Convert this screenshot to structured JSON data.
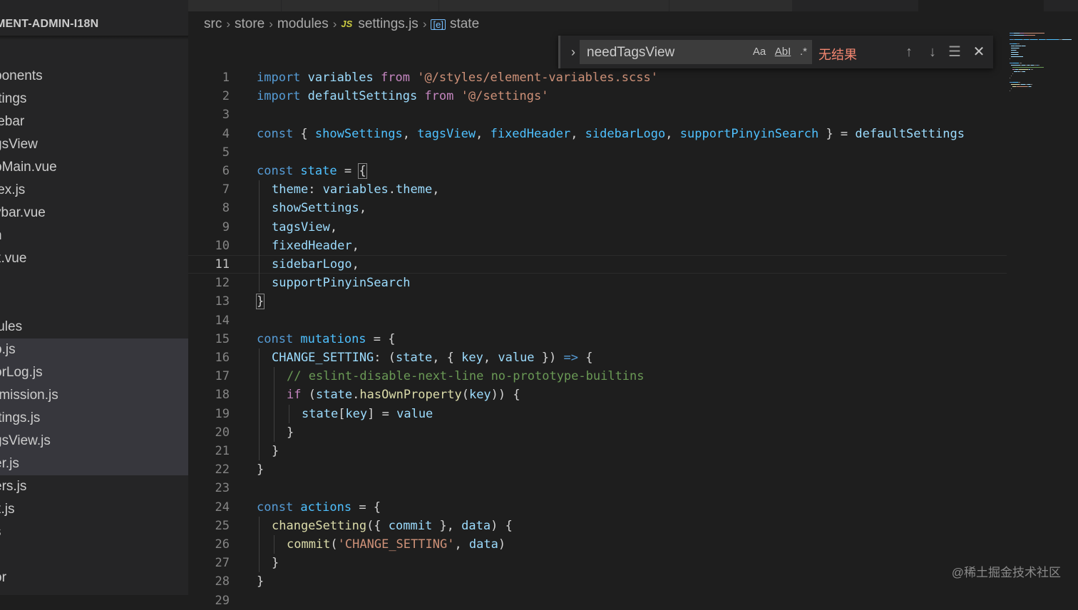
{
  "explorer": {
    "title": "MENT-ADMIN-I18N",
    "items": [
      {
        "label": "t",
        "selected": false
      },
      {
        "label": "ponents",
        "selected": false
      },
      {
        "label": "ttings",
        "selected": false
      },
      {
        "label": "lebar",
        "selected": false
      },
      {
        "label": "gsView",
        "selected": false
      },
      {
        "label": "pMain.vue",
        "selected": false
      },
      {
        "label": "lex.js",
        "selected": false
      },
      {
        "label": "vbar.vue",
        "selected": false
      },
      {
        "label": "n",
        "selected": false
      },
      {
        "label": "x.vue",
        "selected": false
      },
      {
        "label": "r",
        "selected": false
      },
      {
        "label": "",
        "selected": false
      },
      {
        "label": "lules",
        "selected": false
      },
      {
        "label": "p.js",
        "selected": true
      },
      {
        "label": "orLog.js",
        "selected": true
      },
      {
        "label": "rmission.js",
        "selected": true
      },
      {
        "label": "ttings.js",
        "selected": true
      },
      {
        "label": "gsView.js",
        "selected": true
      },
      {
        "label": "er.js",
        "selected": true
      },
      {
        "label": "ers.js",
        "selected": false
      },
      {
        "label": "x.js",
        "selected": false
      },
      {
        "label": "s",
        "selected": false
      },
      {
        "label": "",
        "selected": false
      },
      {
        "label": "or",
        "selected": false
      }
    ]
  },
  "breadcrumb": {
    "src": "src",
    "store": "store",
    "modules": "modules",
    "file_badge": "JS",
    "file": "settings.js",
    "symbol_badge": "[e]",
    "symbol": "state"
  },
  "find": {
    "value": "needTagsView",
    "match_case": "Aa",
    "whole_word": "AbI",
    "regex": ".*",
    "result": "无结果"
  },
  "editor": {
    "current_line": 11,
    "lines": [
      {
        "n": "1",
        "indent": 0,
        "t": [
          [
            "k",
            "import "
          ],
          [
            "v",
            "variables"
          ],
          [
            "kc",
            " from "
          ],
          [
            "s",
            "'@/styles/element-variables.scss'"
          ]
        ]
      },
      {
        "n": "2",
        "indent": 0,
        "t": [
          [
            "k",
            "import "
          ],
          [
            "v",
            "defaultSettings"
          ],
          [
            "kc",
            " from "
          ],
          [
            "s",
            "'@/settings'"
          ]
        ]
      },
      {
        "n": "3",
        "indent": 0,
        "t": []
      },
      {
        "n": "4",
        "indent": 0,
        "t": [
          [
            "k",
            "const "
          ],
          [
            "p",
            "{ "
          ],
          [
            "c",
            "showSettings"
          ],
          [
            "p",
            ", "
          ],
          [
            "c",
            "tagsView"
          ],
          [
            "p",
            ", "
          ],
          [
            "c",
            "fixedHeader"
          ],
          [
            "p",
            ", "
          ],
          [
            "c",
            "sidebarLogo"
          ],
          [
            "p",
            ", "
          ],
          [
            "c",
            "supportPinyinSearch"
          ],
          [
            "p",
            " } = "
          ],
          [
            "v",
            "defaultSettings"
          ]
        ]
      },
      {
        "n": "5",
        "indent": 0,
        "t": []
      },
      {
        "n": "6",
        "indent": 0,
        "t": [
          [
            "k",
            "const "
          ],
          [
            "c",
            "state"
          ],
          [
            "p",
            " = "
          ],
          [
            "pb",
            "{"
          ]
        ]
      },
      {
        "n": "7",
        "indent": 1,
        "t": [
          [
            "v",
            "theme"
          ],
          [
            "p",
            ": "
          ],
          [
            "v",
            "variables"
          ],
          [
            "p",
            "."
          ],
          [
            "v",
            "theme"
          ],
          [
            "p",
            ","
          ]
        ]
      },
      {
        "n": "8",
        "indent": 1,
        "t": [
          [
            "v",
            "showSettings"
          ],
          [
            "p",
            ","
          ]
        ]
      },
      {
        "n": "9",
        "indent": 1,
        "t": [
          [
            "v",
            "tagsView"
          ],
          [
            "p",
            ","
          ]
        ]
      },
      {
        "n": "10",
        "indent": 1,
        "t": [
          [
            "v",
            "fixedHeader"
          ],
          [
            "p",
            ","
          ]
        ]
      },
      {
        "n": "11",
        "indent": 1,
        "t": [
          [
            "v",
            "sidebarLogo"
          ],
          [
            "p",
            ","
          ]
        ]
      },
      {
        "n": "12",
        "indent": 1,
        "t": [
          [
            "v",
            "supportPinyinSearch"
          ]
        ]
      },
      {
        "n": "13",
        "indent": 0,
        "t": [
          [
            "pb",
            "}"
          ]
        ]
      },
      {
        "n": "14",
        "indent": 0,
        "t": []
      },
      {
        "n": "15",
        "indent": 0,
        "t": [
          [
            "k",
            "const "
          ],
          [
            "c",
            "mutations"
          ],
          [
            "p",
            " = {"
          ]
        ]
      },
      {
        "n": "16",
        "indent": 1,
        "t": [
          [
            "v",
            "CHANGE_SETTING"
          ],
          [
            "p",
            ": ("
          ],
          [
            "v",
            "state"
          ],
          [
            "p",
            ", { "
          ],
          [
            "v",
            "key"
          ],
          [
            "p",
            ", "
          ],
          [
            "v",
            "value"
          ],
          [
            "p",
            " }) "
          ],
          [
            "k",
            "=>"
          ],
          [
            "p",
            " {"
          ]
        ]
      },
      {
        "n": "17",
        "indent": 2,
        "t": [
          [
            "cm",
            "// eslint-disable-next-line no-prototype-builtins"
          ]
        ]
      },
      {
        "n": "18",
        "indent": 2,
        "t": [
          [
            "kc",
            "if "
          ],
          [
            "p",
            "("
          ],
          [
            "v",
            "state"
          ],
          [
            "p",
            "."
          ],
          [
            "f",
            "hasOwnProperty"
          ],
          [
            "p",
            "("
          ],
          [
            "v",
            "key"
          ],
          [
            "p",
            ")) {"
          ]
        ]
      },
      {
        "n": "19",
        "indent": 3,
        "t": [
          [
            "v",
            "state"
          ],
          [
            "p",
            "["
          ],
          [
            "v",
            "key"
          ],
          [
            "p",
            "] = "
          ],
          [
            "v",
            "value"
          ]
        ]
      },
      {
        "n": "20",
        "indent": 2,
        "t": [
          [
            "p",
            "}"
          ]
        ]
      },
      {
        "n": "21",
        "indent": 1,
        "t": [
          [
            "p",
            "}"
          ]
        ]
      },
      {
        "n": "22",
        "indent": 0,
        "t": [
          [
            "p",
            "}"
          ]
        ]
      },
      {
        "n": "23",
        "indent": 0,
        "t": []
      },
      {
        "n": "24",
        "indent": 0,
        "t": [
          [
            "k",
            "const "
          ],
          [
            "c",
            "actions"
          ],
          [
            "p",
            " = {"
          ]
        ]
      },
      {
        "n": "25",
        "indent": 1,
        "t": [
          [
            "f",
            "changeSetting"
          ],
          [
            "p",
            "({ "
          ],
          [
            "v",
            "commit"
          ],
          [
            "p",
            " }, "
          ],
          [
            "v",
            "data"
          ],
          [
            "p",
            ") {"
          ]
        ]
      },
      {
        "n": "26",
        "indent": 2,
        "t": [
          [
            "f",
            "commit"
          ],
          [
            "p",
            "("
          ],
          [
            "s",
            "'CHANGE_SETTING'"
          ],
          [
            "p",
            ", "
          ],
          [
            "v",
            "data"
          ],
          [
            "p",
            ")"
          ]
        ]
      },
      {
        "n": "27",
        "indent": 1,
        "t": [
          [
            "p",
            "}"
          ]
        ]
      },
      {
        "n": "28",
        "indent": 0,
        "t": [
          [
            "p",
            "}"
          ]
        ]
      },
      {
        "n": "29",
        "indent": 0,
        "t": []
      }
    ]
  },
  "watermark": "@稀土掘金技术社区",
  "icons": {
    "find_toggle": "chevron-right-icon",
    "prev": "arrow-up-icon",
    "next": "arrow-down-icon",
    "selection": "find-in-selection-icon",
    "close": "close-icon"
  }
}
